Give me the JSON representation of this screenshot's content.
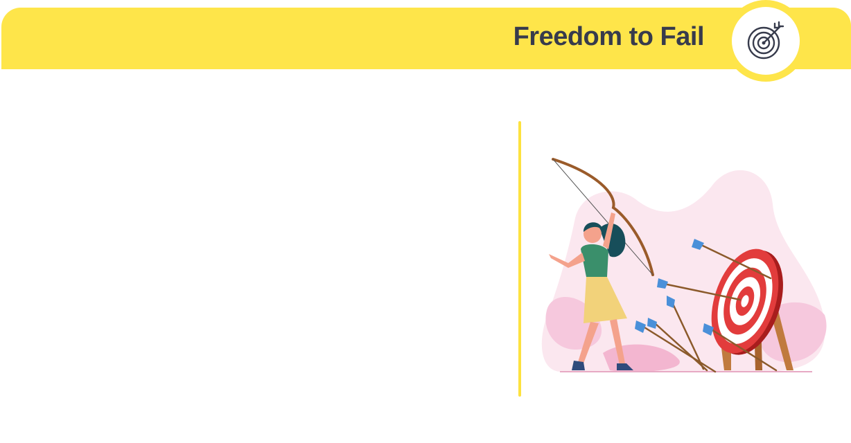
{
  "header": {
    "title": "Freedom to Fail",
    "icon": "target-arrow-icon",
    "accent_color": "#fee54a",
    "title_color": "#373b4c"
  },
  "illustration": {
    "icon": "archer-woman-target-illustration"
  }
}
